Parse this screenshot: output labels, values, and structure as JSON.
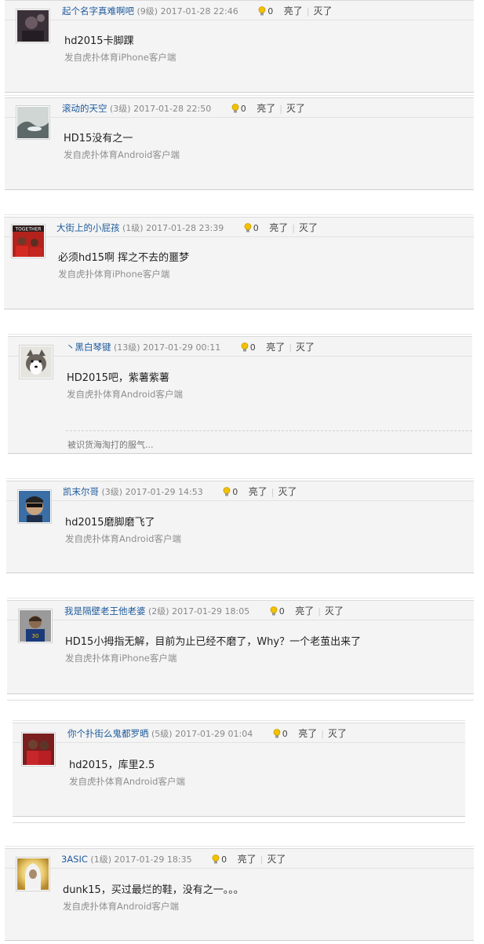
{
  "ui": {
    "like_label": "亮了",
    "bury_label": "灭了",
    "separator": "|",
    "bulb_color": "#f2c200"
  },
  "comments": [
    {
      "user": "起个名字真难啊吧",
      "level": "(9级)",
      "time": "2017-01-28 22:46",
      "likes": "0",
      "text": "hd2015卡脚踝",
      "source": "发自虎扑体育iPhone客户端",
      "avatar": "dark-portrait-icon"
    },
    {
      "user": "滚动的天空",
      "level": "(3级)",
      "time": "2017-01-28 22:50",
      "likes": "0",
      "text": "HD15没有之一",
      "source": "发自虎扑体育Android客户端",
      "avatar": "landscape-photo-icon"
    },
    {
      "user": "大街上的小屁孩",
      "level": "(1级)",
      "time": "2017-01-28 23:39",
      "likes": "0",
      "text": "必须hd15啊 挥之不去的噩梦",
      "source": "发自虎扑体育iPhone客户端",
      "avatar": "red-jersey-photo-icon",
      "avatar_text": "TOGETHER"
    },
    {
      "user": "丶黑白琴键",
      "level": "(13级)",
      "time": "2017-01-29 00:11",
      "likes": "0",
      "text": "HD2015吧，紫薯紫薯",
      "source": "发自虎扑体育Android客户端",
      "reply": "被识货海淘打的服气...",
      "avatar": "husky-dog-icon"
    },
    {
      "user": "凯末尔哥",
      "level": "(3级)",
      "time": "2017-01-29 14:53",
      "likes": "0",
      "text": "hd2015磨脚磨飞了",
      "source": "发自虎扑体育Android客户端",
      "avatar": "sunglasses-portrait-icon"
    },
    {
      "user": "我是隔壁老王他老婆",
      "level": "(2级)",
      "time": "2017-01-29 18:05",
      "likes": "0",
      "text": "HD15小拇指无解，目前为止已经不磨了，Why？一个老茧出来了",
      "source": "发自虎扑体育iPhone客户端",
      "avatar": "player-photo-icon"
    },
    {
      "user": "你个扑街么鬼都罗晒",
      "level": "(5级)",
      "time": "2017-01-29 01:04",
      "likes": "0",
      "text": "hd2015，库里2.5",
      "source": "发自虎扑体育Android客户端",
      "avatar": "players-photo-icon"
    },
    {
      "user": "3ASIC",
      "level": "(1级)",
      "time": "2017-01-29 18:35",
      "likes": "0",
      "text": "dunk15，买过最烂的鞋，没有之一。。。",
      "source": "发自虎扑体育Android客户端",
      "avatar": "hooded-figure-icon"
    }
  ]
}
